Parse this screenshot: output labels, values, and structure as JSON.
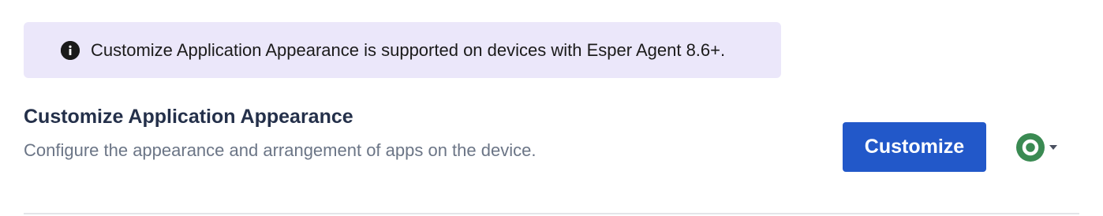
{
  "banner": {
    "icon": "info-icon",
    "text": "Customize Application Appearance is supported on devices with Esper Agent 8.6+."
  },
  "setting": {
    "title": "Customize Application Appearance",
    "description": "Configure the appearance and arrangement of apps on the device.",
    "button_label": "Customize",
    "status_icon": "status-ring-icon",
    "status_color": "#3a8a52",
    "dropdown_icon": "caret-down-icon"
  },
  "colors": {
    "banner_bg": "#ebe7fa",
    "primary_button": "#2258c9",
    "title_text": "#24304a",
    "description_text": "#6b7586"
  }
}
